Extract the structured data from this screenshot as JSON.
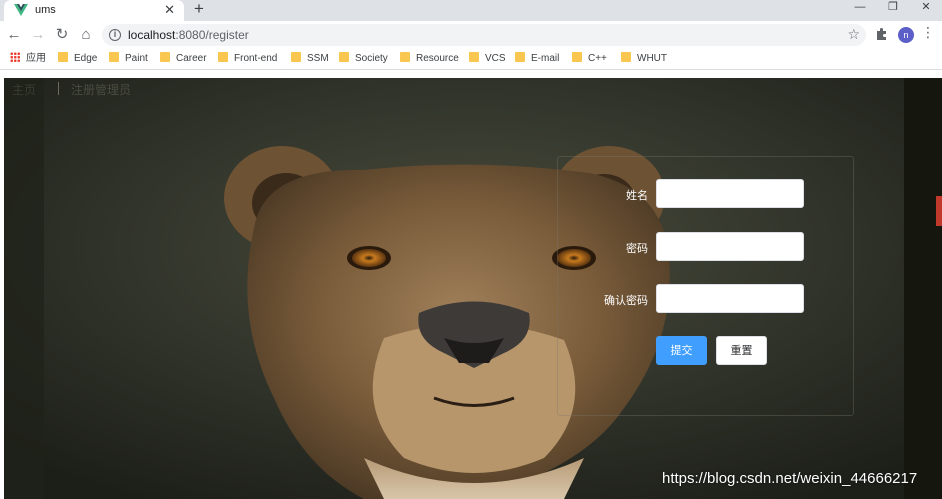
{
  "browser": {
    "tab_title": "ums",
    "tab_close": "✕",
    "new_tab": "+",
    "url_host": "localhost",
    "url_rest": ":8080/register",
    "profile_initial": "n",
    "bookmarks": [
      "应用",
      "Edge",
      "Paint",
      "Career",
      "Front-end",
      "SSM",
      "Society",
      "Resource",
      "VCS",
      "E-mail",
      "C++",
      "WHUT"
    ]
  },
  "page": {
    "brand": "主页",
    "heading": "注册管理员",
    "form": {
      "name_label": "姓名",
      "password_label": "密码",
      "confirm_label": "确认密码",
      "submit_label": "提交",
      "reset_label": "重置"
    }
  },
  "watermark": "https://blog.csdn.net/weixin_44666217",
  "colors": {
    "primary": "#409eff",
    "tabstrip": "#dee1e6"
  }
}
